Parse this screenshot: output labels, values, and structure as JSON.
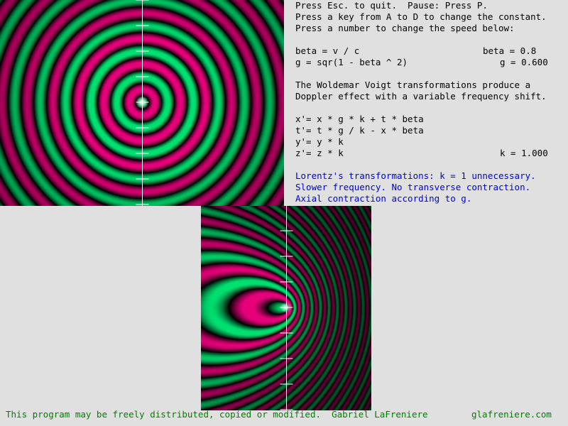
{
  "instructions": [
    "Press Esc. to quit.  Pause: Press P.",
    "Press a key from A to D to change the constant.",
    "Press a number to change the speed below:"
  ],
  "formulas": {
    "beta_formula": "beta = v / c",
    "beta_value": "beta = 0.8",
    "g_formula": "g = sqr(1 - beta ^ 2)",
    "g_value": "g = 0.600"
  },
  "description": [
    "The Woldemar Voigt transformations produce a",
    "Doppler effect with a variable frequency shift."
  ],
  "transforms": [
    "x'= x * g * k + t * beta",
    "t'= t * g / k - x * beta",
    "y'= y * k",
    "z'= z * k"
  ],
  "k_value": "k = 1.000",
  "lorentz_note": [
    "Lorentz's transformations: k = 1 unnecessary.",
    "Slower frequency. No transverse contraction.",
    "Axial contraction according to g."
  ],
  "footer": {
    "left": "This program may be freely distributed, copied or modified.  Gabriel LaFreniere",
    "right": "glafreniere.com"
  },
  "colors": {
    "background": "#e0e0e0",
    "wave_positive": "#e6007a",
    "wave_negative": "#00e070",
    "text_blue": "#0000e0",
    "footer_green": "#008000",
    "scale_line": "#ffffff"
  },
  "physics": {
    "beta": 0.8,
    "g": 0.6,
    "k": 1.0
  }
}
